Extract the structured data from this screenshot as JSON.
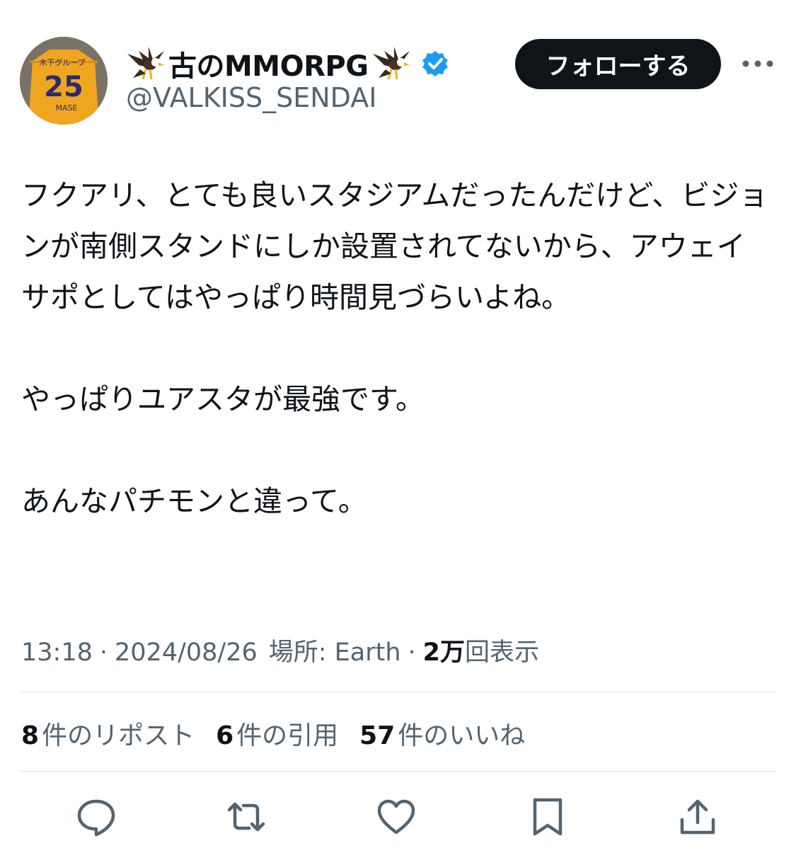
{
  "user": {
    "display_name": "古のMMORPG",
    "handle": "@VALKISS_SENDAI",
    "avatar_text": {
      "sponsor": "木下グループ",
      "number": "25",
      "player": "MASE"
    }
  },
  "follow_label": "フォローする",
  "tweet": {
    "paragraphs": [
      "フクアリ、とても良いスタジアムだったんだけど、ビジョンが南側スタンドにしか設置されてないから、アウェイサポとしてはやっぱり時間見づらいよね。",
      "やっぱりユアスタが最強です。",
      "あんなパチモンと違って。"
    ]
  },
  "meta": {
    "time": "13:18",
    "date": "2024/08/26",
    "location": "場所: Earth",
    "views_count": "2万",
    "views_label": "回表示"
  },
  "stats": {
    "reposts_count": "8",
    "reposts_label": "件のリポスト",
    "quotes_count": "6",
    "quotes_label": "件の引用",
    "likes_count": "57",
    "likes_label": "件のいいね"
  },
  "colors": {
    "text": "#0f1419",
    "muted": "#536471",
    "verified": "#1d9bf0",
    "jersey": "#f0a51f",
    "divider": "#dfe3e6"
  },
  "icons": [
    "eagle-icon",
    "verified-badge-icon",
    "more-icon",
    "reply-icon",
    "repost-icon",
    "like-icon",
    "bookmark-icon",
    "share-icon"
  ]
}
